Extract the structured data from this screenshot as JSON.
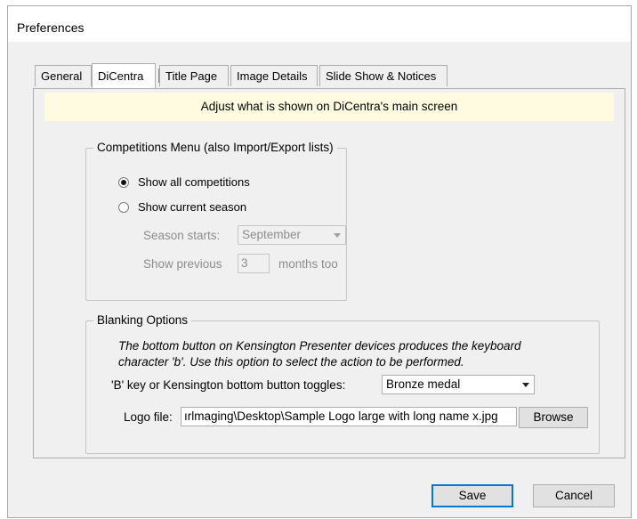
{
  "window": {
    "title": "Preferences"
  },
  "tabs": [
    {
      "label": "General",
      "active": false
    },
    {
      "label": "DiCentra",
      "active": true
    },
    {
      "label": "Title Page",
      "active": false
    },
    {
      "label": "Image Details",
      "active": false
    },
    {
      "label": "Slide Show & Notices",
      "active": false
    }
  ],
  "banner": {
    "text": "Adjust what is shown on DiCentra's main screen",
    "color": "#fffbe0"
  },
  "competitions_group": {
    "legend": "Competitions Menu (also Import/Export lists)",
    "show_all_label": "Show all competitions",
    "show_all_selected": true,
    "show_current_label": "Show current season",
    "show_current_selected": false,
    "season_starts_label": "Season starts:",
    "season_starts_value": "September",
    "show_previous_label": "Show previous",
    "show_previous_value": "3",
    "months_too_label": "months too"
  },
  "blanking_group": {
    "legend": "Blanking Options",
    "description_line1": "The bottom button on Kensington Presenter devices produces the keyboard",
    "description_line2": "character 'b'.  Use this option to select the action to be performed.",
    "toggle_label": "'B' key or Kensington bottom button toggles:",
    "toggle_value": "Bronze medal",
    "logo_label": "Logo file:",
    "logo_value": "ırlmaging\\Desktop\\Sample Logo large  with long name x.jpg",
    "browse_label": "Browse"
  },
  "footer": {
    "save_label": "Save",
    "cancel_label": "Cancel",
    "focus_color": "#0078d7"
  }
}
